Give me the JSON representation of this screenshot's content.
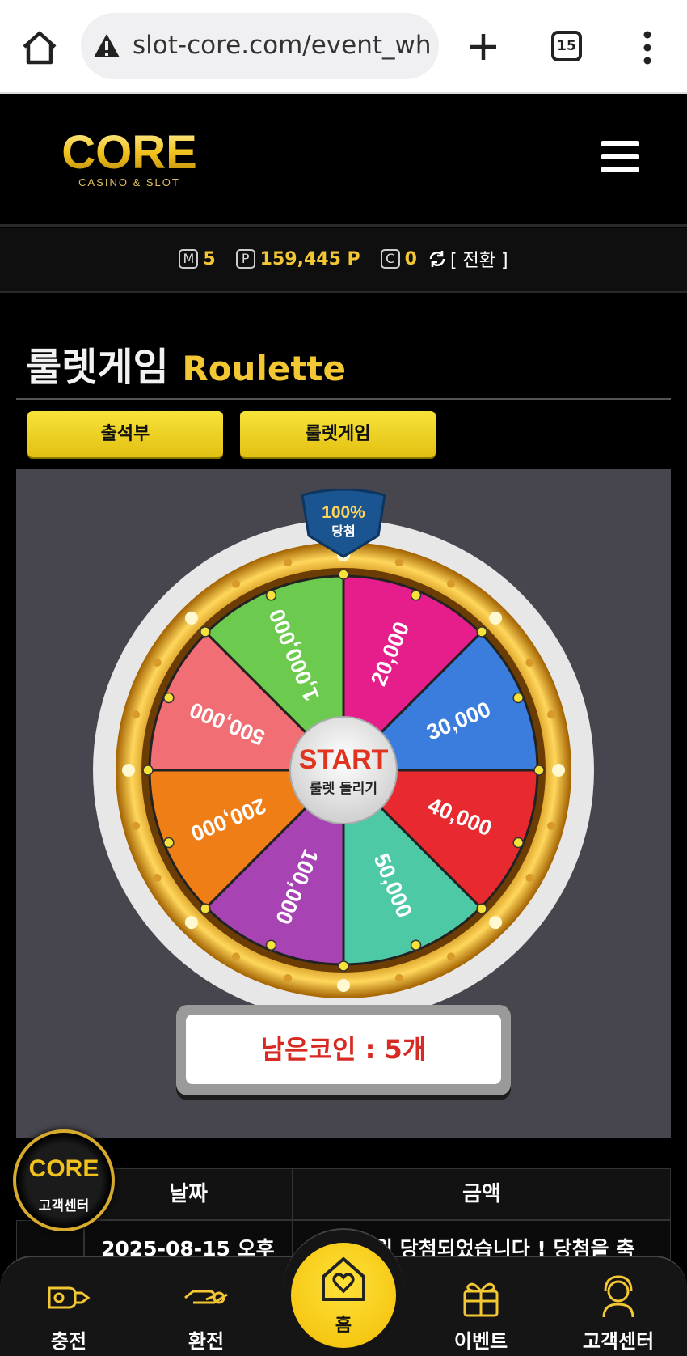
{
  "browser": {
    "url": "slot-core.com/event_wheel",
    "tab_count": "15"
  },
  "header": {
    "logo_text": "CORE",
    "logo_subtitle": "CASINO & SLOT"
  },
  "points": {
    "m_icon": "M",
    "m_value": "5",
    "p_icon": "P",
    "p_value": "159,445 P",
    "c_icon": "C",
    "c_value": "0",
    "swap_label": "[ 전환 ]"
  },
  "page": {
    "title_ko": "룰렛게임",
    "title_en": "Roulette"
  },
  "tabs": [
    {
      "label": "출석부"
    },
    {
      "label": "룰렛게임"
    }
  ],
  "wheel": {
    "badge_top": "100%",
    "badge_bottom": "당첨",
    "start_label": "START",
    "start_sub": "룰렛 돌리기",
    "segments": [
      {
        "label": "20,000",
        "color": "#e61e8c"
      },
      {
        "label": "30,000",
        "color": "#3b7ddd"
      },
      {
        "label": "40,000",
        "color": "#e82a30"
      },
      {
        "label": "50,000",
        "color": "#4dc9a6"
      },
      {
        "label": "100,000",
        "color": "#a843b4"
      },
      {
        "label": "200,000",
        "color": "#f07e16"
      },
      {
        "label": "500,000",
        "color": "#f06e74"
      },
      {
        "label": "1,000,000",
        "color": "#6ccb4e"
      }
    ]
  },
  "coins": {
    "remaining_label": "남은코인 : 5개"
  },
  "table": {
    "headers": [
      "날짜",
      "금액"
    ],
    "row": {
      "date": "2025-08-15 오후",
      "amount": "원 당첨되었습니다 ! 당첨을 축"
    }
  },
  "customer_service": {
    "logo_text": "CORE",
    "label": "고객센터"
  },
  "bottom_nav": {
    "items": [
      {
        "label": "충전"
      },
      {
        "label": "환전"
      },
      {
        "label": "홈"
      },
      {
        "label": "이벤트"
      },
      {
        "label": "고객센터"
      }
    ]
  },
  "colors": {
    "accent_gold": "#f3c734",
    "coin_red": "#d72a22"
  }
}
